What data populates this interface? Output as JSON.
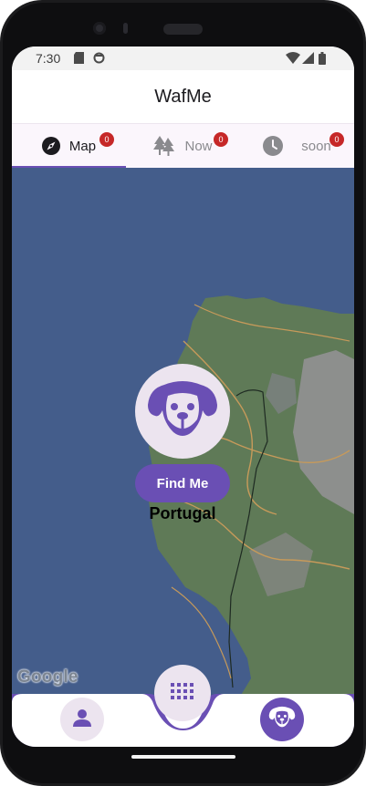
{
  "status_bar": {
    "time": "7:30",
    "icons": [
      "sd-card-icon",
      "sync-icon",
      "wifi-icon",
      "signal-icon",
      "battery-icon"
    ]
  },
  "app_bar": {
    "title": "WafMe"
  },
  "tabs": [
    {
      "label": "Map",
      "icon": "compass-icon",
      "badge": "0",
      "active": true
    },
    {
      "label": "Now",
      "icon": "trees-icon",
      "badge": "0",
      "active": false
    },
    {
      "label": "soon",
      "icon": "clock-icon",
      "badge": "0",
      "active": false
    }
  ],
  "map": {
    "country_label": "Portugal",
    "find_me_label": "Find Me",
    "attribution": "Google"
  },
  "bottom_nav": {
    "items": [
      "person-icon",
      "grid-icon",
      "dog-icon"
    ],
    "selected": "dog-icon"
  },
  "colors": {
    "accent": "#6a4fb4",
    "accent_light": "#ece4ef",
    "ocean": "#445d8b",
    "land": "#5e7a5a",
    "badge": "#c62828"
  }
}
